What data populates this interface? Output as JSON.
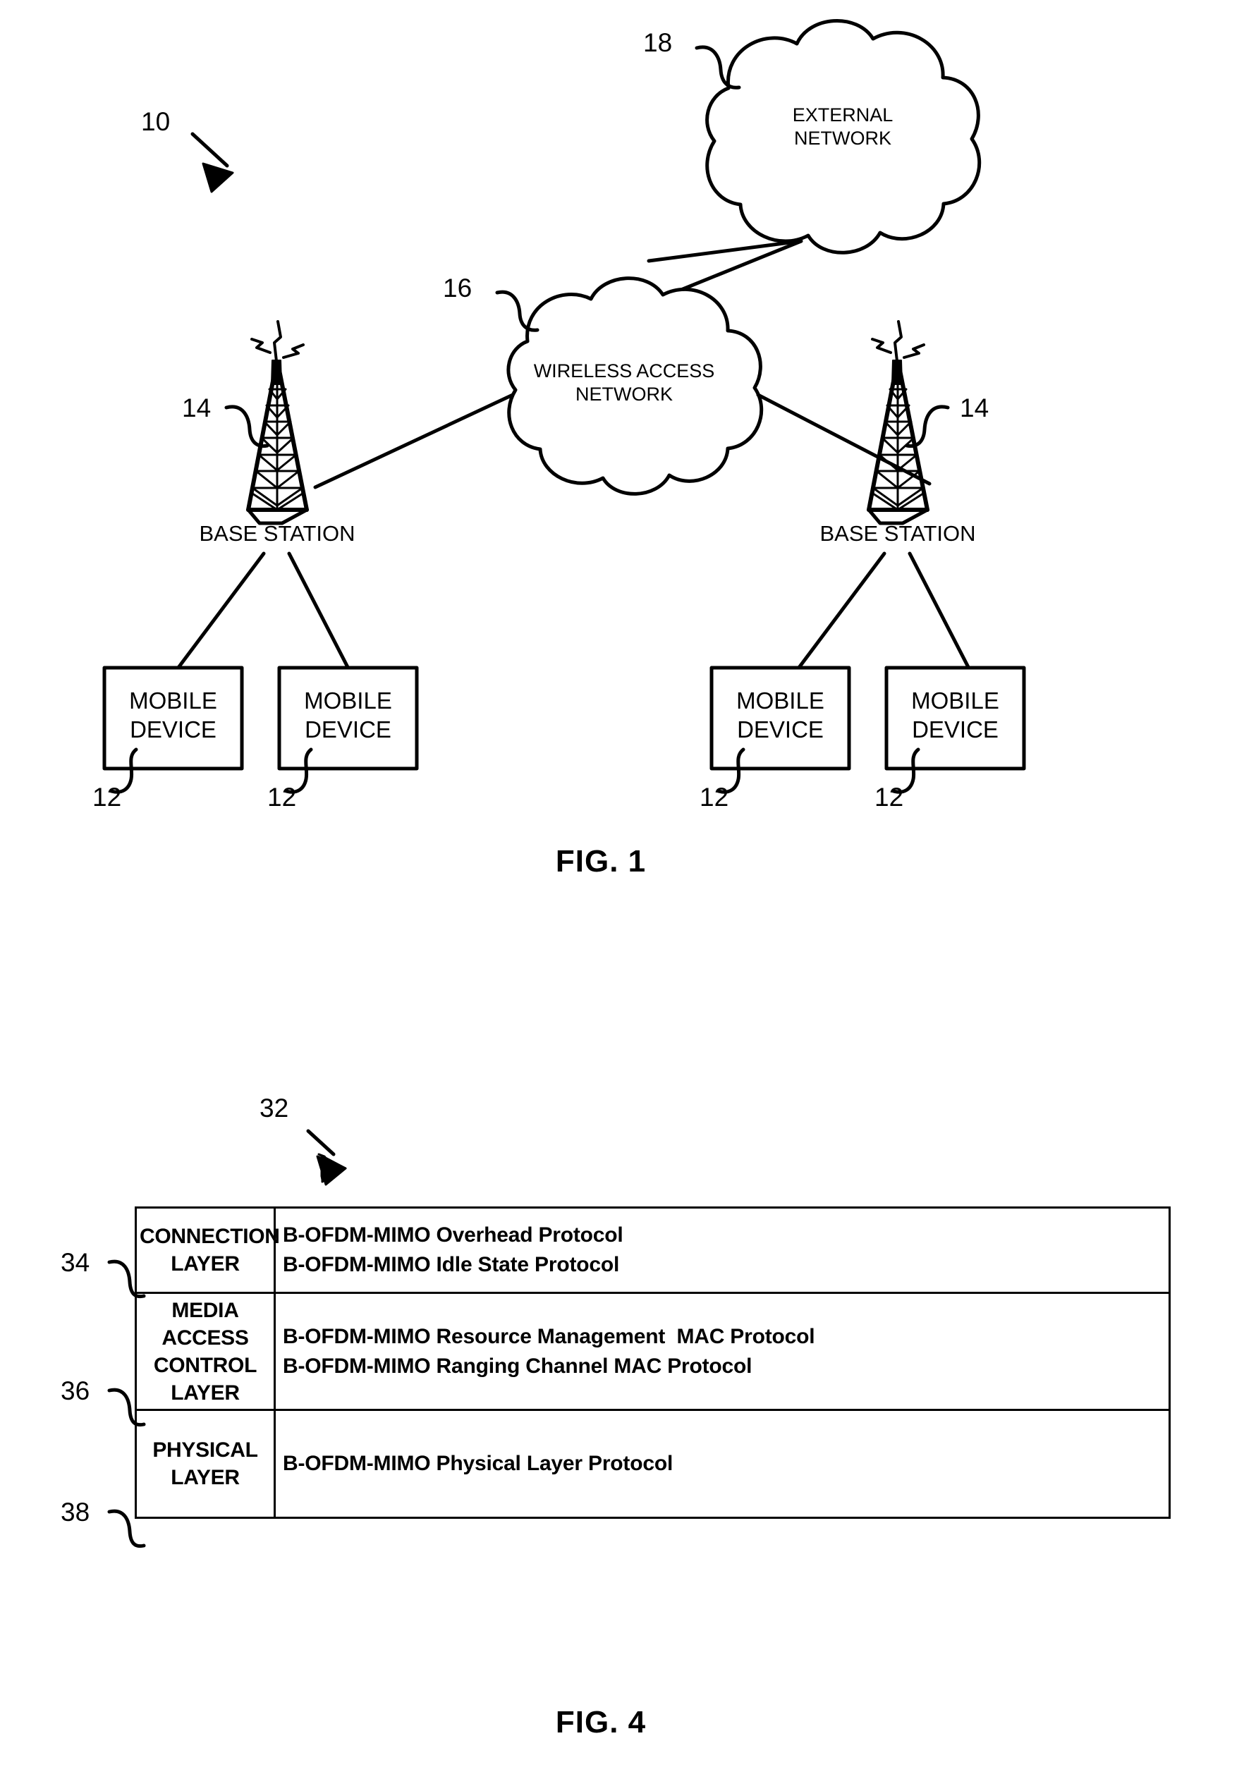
{
  "figure1": {
    "caption": "FIG. 1",
    "system_ref": "10",
    "nodes": {
      "external_network": {
        "ref": "18",
        "label_line1": "EXTERNAL",
        "label_line2": "NETWORK"
      },
      "wireless_access_network": {
        "ref": "16",
        "label_line1": "WIRELESS ACCESS",
        "label_line2": "NETWORK"
      },
      "base_station_left": {
        "ref": "14",
        "label": "BASE STATION"
      },
      "base_station_right": {
        "ref": "14",
        "label": "BASE STATION"
      },
      "mobile_devices": [
        {
          "ref": "12",
          "label_line1": "MOBILE",
          "label_line2": "DEVICE"
        },
        {
          "ref": "12",
          "label_line1": "MOBILE",
          "label_line2": "DEVICE"
        },
        {
          "ref": "12",
          "label_line1": "MOBILE",
          "label_line2": "DEVICE"
        },
        {
          "ref": "12",
          "label_line1": "MOBILE",
          "label_line2": "DEVICE"
        }
      ]
    }
  },
  "figure4": {
    "caption": "FIG. 4",
    "stack_ref": "32",
    "rows": [
      {
        "ref": "34",
        "layer_line1": "CONNECTION",
        "layer_line2": "LAYER",
        "layer_line3": "",
        "layer_line4": "",
        "protocol1": "B-OFDM-MIMO Overhead Protocol",
        "protocol2": "B-OFDM-MIMO Idle State Protocol"
      },
      {
        "ref": "36",
        "layer_line1": "MEDIA",
        "layer_line2": "ACCESS",
        "layer_line3": "CONTROL",
        "layer_line4": "LAYER",
        "protocol1": "B-OFDM-MIMO Resource Management  MAC Protocol",
        "protocol2": "B-OFDM-MIMO Ranging Channel MAC Protocol"
      },
      {
        "ref": "38",
        "layer_line1": "PHYSICAL",
        "layer_line2": "LAYER",
        "layer_line3": "",
        "layer_line4": "",
        "protocol1": "B-OFDM-MIMO Physical Layer Protocol",
        "protocol2": ""
      }
    ]
  },
  "colors": {
    "ink": "#000000",
    "paper": "#ffffff"
  }
}
